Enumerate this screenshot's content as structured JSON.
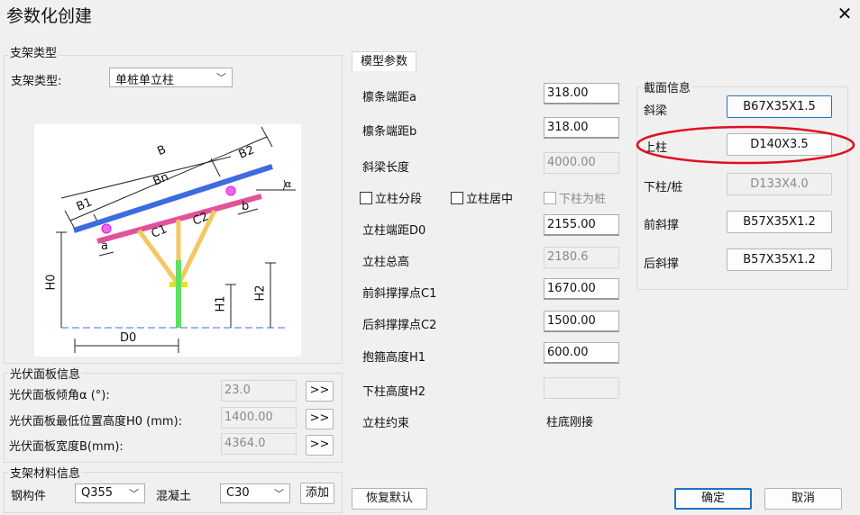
{
  "window": {
    "title": "参数化创建",
    "close": "✕"
  },
  "bracket_type": {
    "group_title": "支架类型",
    "label": "支架类型:",
    "value": "单桩单立柱"
  },
  "diagram": {
    "B": "B",
    "Bn": "Bn",
    "B1": "B1",
    "B2": "B2",
    "C1": "C1",
    "C2": "C2",
    "a": "a",
    "b": "b",
    "H0": "H0",
    "H1": "H1",
    "H2": "H2",
    "D0": "D0",
    "alpha": "α"
  },
  "pv_panel": {
    "group_title": "光伏面板信息",
    "rows": [
      {
        "label": "光伏面板倾角α (°):",
        "value": "23.0",
        "btn": ">>"
      },
      {
        "label": "光伏面板最低位置高度H0 (mm):",
        "value": "1400.00",
        "btn": ">>"
      },
      {
        "label": "光伏面板宽度B(mm):",
        "value": "4364.0",
        "btn": ">>"
      }
    ]
  },
  "material": {
    "group_title": "支架材料信息",
    "steel_label": "钢构件",
    "steel_value": "Q355",
    "concrete_label": "混凝土",
    "concrete_value": "C30",
    "add_button": "添加"
  },
  "model_params": {
    "tab": "模型参数",
    "rows": [
      {
        "label": "檩条端距a",
        "value": "318.00"
      },
      {
        "label": "檩条端距b",
        "value": "318.00"
      },
      {
        "label": "斜梁长度",
        "value": "4000.00"
      },
      {
        "label": "立柱端距D0",
        "value": "2155.00"
      },
      {
        "label": "立柱总高",
        "value": "2180.6"
      },
      {
        "label": "前斜撑撑点C1",
        "value": "1670.00"
      },
      {
        "label": "后斜撑撑点C2",
        "value": "1500.00"
      },
      {
        "label": "抱箍高度H1",
        "value": "600.00"
      },
      {
        "label": "下柱高度H2",
        "value": ""
      },
      {
        "label": "立柱约束",
        "value": "柱底刚接"
      }
    ],
    "checkboxes": [
      {
        "label": "立柱分段"
      },
      {
        "label": "立柱居中"
      },
      {
        "label": "下柱为桩"
      }
    ]
  },
  "section": {
    "group_title": "截面信息",
    "rows": [
      {
        "label": "斜梁",
        "value": "B67X35X1.5"
      },
      {
        "label": "上柱",
        "value": "D140X3.5"
      },
      {
        "label": "下柱/桩",
        "value": "D133X4.0"
      },
      {
        "label": "前斜撑",
        "value": "B57X35X1.2"
      },
      {
        "label": "后斜撑",
        "value": "B57X35X1.2"
      }
    ]
  },
  "footer": {
    "restore": "恢复默认",
    "ok": "确定",
    "cancel": "取消"
  },
  "colors": {
    "beam_blue": "#3d6be0",
    "purlin_pink": "#e2529a",
    "brace_yellow": "#f2c860",
    "column_green": "#5ee060",
    "highlight_red": "#e01020",
    "accent_blue": "#1e73c7"
  }
}
